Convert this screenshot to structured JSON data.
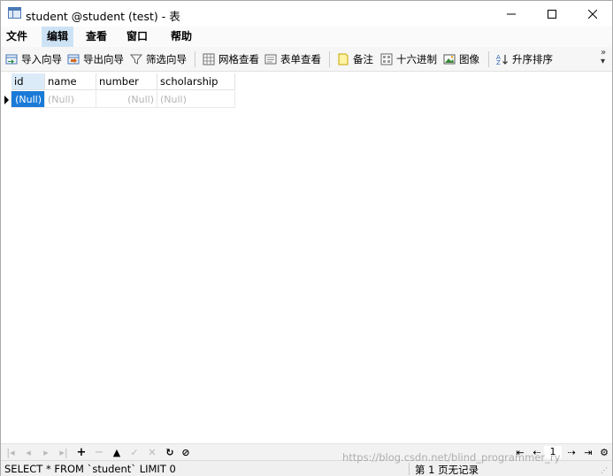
{
  "window": {
    "title": "student @student (test) - 表"
  },
  "menu": {
    "items": [
      {
        "label": "文件"
      },
      {
        "label": "编辑"
      },
      {
        "label": "查看"
      },
      {
        "label": "窗口"
      },
      {
        "label": "帮助"
      }
    ]
  },
  "toolbar": {
    "import_label": "导入向导",
    "export_label": "导出向导",
    "filter_label": "筛选向导",
    "grid_view_label": "网格查看",
    "form_view_label": "表单查看",
    "memo_label": "备注",
    "hex_label": "十六进制",
    "image_label": "图像",
    "sort_label": "升序排序",
    "more": "»",
    "more_down": "▾"
  },
  "grid": {
    "columns": [
      "id",
      "name",
      "number",
      "scholarship"
    ],
    "rows": [
      [
        "(Null)",
        "(Null)",
        "(Null)",
        "(Null)"
      ]
    ]
  },
  "navbar": {
    "page": "1"
  },
  "status": {
    "sql": "SELECT * FROM `student` LIMIT 0",
    "records": "第 1 页无记录"
  },
  "watermark": "https://blog.csdn.net/blind_programmer_ry",
  "colors": {
    "selected_cell": "#1a7ad8",
    "menu_active": "#cde3f5",
    "null_text": "#b5b5b5"
  }
}
